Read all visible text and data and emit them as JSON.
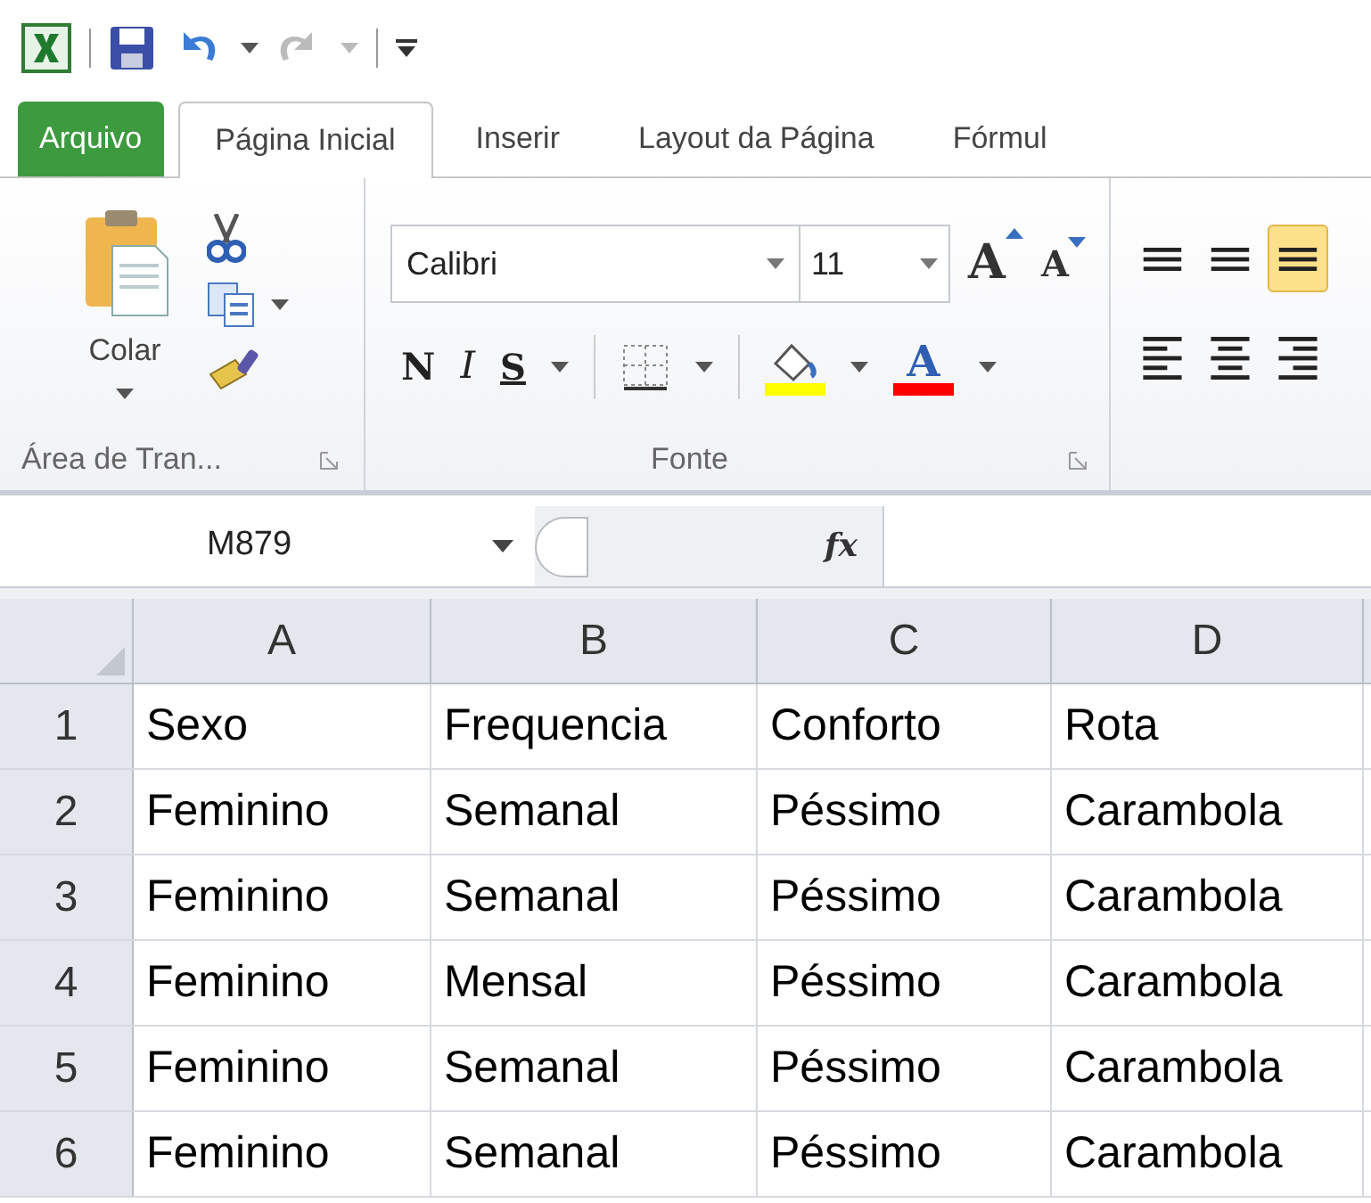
{
  "tabs": [
    {
      "label": "Arquivo",
      "kind": "file",
      "selected": false
    },
    {
      "label": "Página Inicial",
      "kind": "tab",
      "selected": true
    },
    {
      "label": "Inserir",
      "kind": "tab",
      "selected": false
    },
    {
      "label": "Layout da Página",
      "kind": "tab",
      "selected": false
    },
    {
      "label": "Fórmul",
      "kind": "tab",
      "selected": false
    }
  ],
  "clipboard": {
    "paste_label": "Colar",
    "group_label": "Área de Tran..."
  },
  "font": {
    "name": "Calibri",
    "size": "11",
    "grow": "A",
    "shrink": "A",
    "bold": "N",
    "italic": "I",
    "underline": "S",
    "font_color": "A",
    "group_label": "Fonte"
  },
  "alignment": [
    {
      "kind": "top",
      "selected": false
    },
    {
      "kind": "middle",
      "selected": false
    },
    {
      "kind": "bottom",
      "selected": true
    },
    {
      "kind": "left",
      "selected": false
    },
    {
      "kind": "center",
      "selected": false
    },
    {
      "kind": "right",
      "selected": false
    }
  ],
  "formula_bar": {
    "name_box": "M879",
    "fx": "fx"
  },
  "columns": [
    "A",
    "B",
    "C",
    "D"
  ],
  "rows": [
    {
      "number": "1",
      "cells": [
        "Sexo",
        "Frequencia",
        "Conforto",
        "Rota"
      ]
    },
    {
      "number": "2",
      "cells": [
        "Feminino",
        "Semanal",
        "Péssimo",
        "Carambola"
      ]
    },
    {
      "number": "3",
      "cells": [
        "Feminino",
        "Semanal",
        "Péssimo",
        "Carambola"
      ]
    },
    {
      "number": "4",
      "cells": [
        "Feminino",
        "Mensal",
        "Péssimo",
        "Carambola"
      ]
    },
    {
      "number": "5",
      "cells": [
        "Feminino",
        "Semanal",
        "Péssimo",
        "Carambola"
      ]
    },
    {
      "number": "6",
      "cells": [
        "Feminino",
        "Semanal",
        "Péssimo",
        "Carambola"
      ]
    }
  ]
}
